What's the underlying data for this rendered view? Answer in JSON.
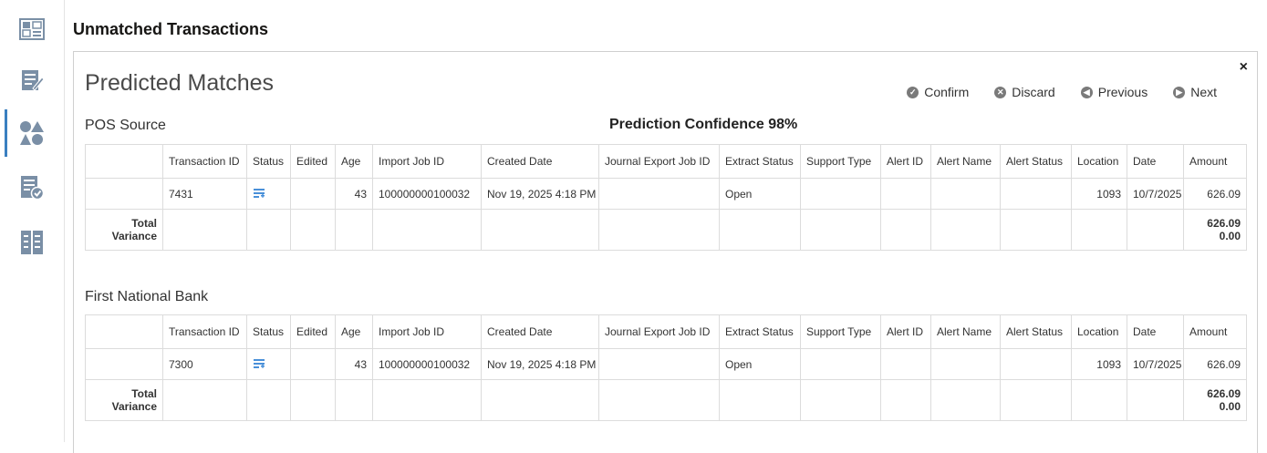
{
  "page_title": "Unmatched Transactions",
  "panel": {
    "title": "Predicted Matches",
    "close_label": "×",
    "actions": [
      {
        "label": "Confirm",
        "icon": "check-circle-icon"
      },
      {
        "label": "Discard",
        "icon": "x-circle-icon"
      },
      {
        "label": "Previous",
        "icon": "arrow-left-circle-icon"
      },
      {
        "label": "Next",
        "icon": "arrow-right-circle-icon"
      }
    ],
    "confidence": "Prediction Confidence 98%"
  },
  "columns": [
    "",
    "Transaction ID",
    "Status",
    "Edited",
    "Age",
    "Import Job ID",
    "Created Date",
    "Journal Export Job ID",
    "Extract Status",
    "Support Type",
    "Alert ID",
    "Alert Name",
    "Alert Status",
    "Location",
    "Date",
    "Amount"
  ],
  "sections": [
    {
      "title": "POS Source",
      "row": {
        "transaction_id": "7431",
        "status_icon": "list-add-icon",
        "edited": "",
        "age": "43",
        "import_job_id": "100000000100032",
        "created_date": "Nov 19, 2025 4:18 PM",
        "journal_export_job_id": "",
        "extract_status": "Open",
        "support_type": "",
        "alert_id": "",
        "alert_name": "",
        "alert_status": "",
        "location": "1093",
        "date": "10/7/2025",
        "amount": "626.09"
      },
      "total": {
        "label_line1": "Total",
        "label_line2": "Variance",
        "amount_total": "626.09",
        "amount_variance": "0.00"
      }
    },
    {
      "title": "First National Bank",
      "row": {
        "transaction_id": "7300",
        "status_icon": "list-add-icon",
        "edited": "",
        "age": "43",
        "import_job_id": "100000000100032",
        "created_date": "Nov 19, 2025 4:18 PM",
        "journal_export_job_id": "",
        "extract_status": "Open",
        "support_type": "",
        "alert_id": "",
        "alert_name": "",
        "alert_status": "",
        "location": "1093",
        "date": "10/7/2025",
        "amount": "626.09"
      },
      "total": {
        "label_line1": "Total",
        "label_line2": "Variance",
        "amount_total": "626.09",
        "amount_variance": "0.00"
      }
    }
  ],
  "nav_rail": [
    {
      "icon": "dashboard-icon"
    },
    {
      "icon": "edit-list-icon"
    },
    {
      "icon": "shapes-icon"
    },
    {
      "icon": "checklist-icon"
    },
    {
      "icon": "document-list-icon"
    }
  ],
  "colors": {
    "accent": "#3a7fc0",
    "icon_gray": "#7a8fa6",
    "status_icon": "#4a90d9"
  }
}
